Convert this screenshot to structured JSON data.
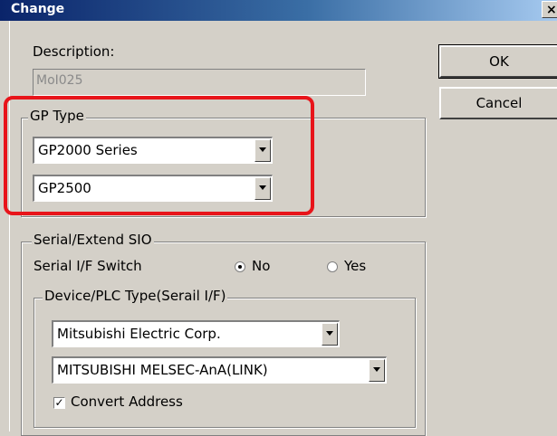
{
  "window": {
    "title": "Change",
    "close_symbol": "×"
  },
  "description": {
    "label": "Description:",
    "value": "MoI025"
  },
  "buttons": {
    "ok": "OK",
    "cancel": "Cancel"
  },
  "gp_type": {
    "legend": "GP Type",
    "series_value": "GP2000 Series",
    "model_value": "GP2500"
  },
  "serial": {
    "legend": "Serial/Extend SIO",
    "switch_label": "Serial I/F Switch",
    "options": [
      "No",
      "Yes"
    ],
    "selected": "No"
  },
  "device": {
    "legend": "Device/PLC Type(Serail I/F)",
    "maker_value": "Mitsubishi Electric Corp.",
    "type_value": "MITSUBISHI MELSEC-AnA(LINK)",
    "convert_label": "Convert Address",
    "convert_checked": true,
    "check_mark": "✓"
  },
  "colors": {
    "highlight": "#e8141a",
    "title_bar": "#0a246a"
  }
}
